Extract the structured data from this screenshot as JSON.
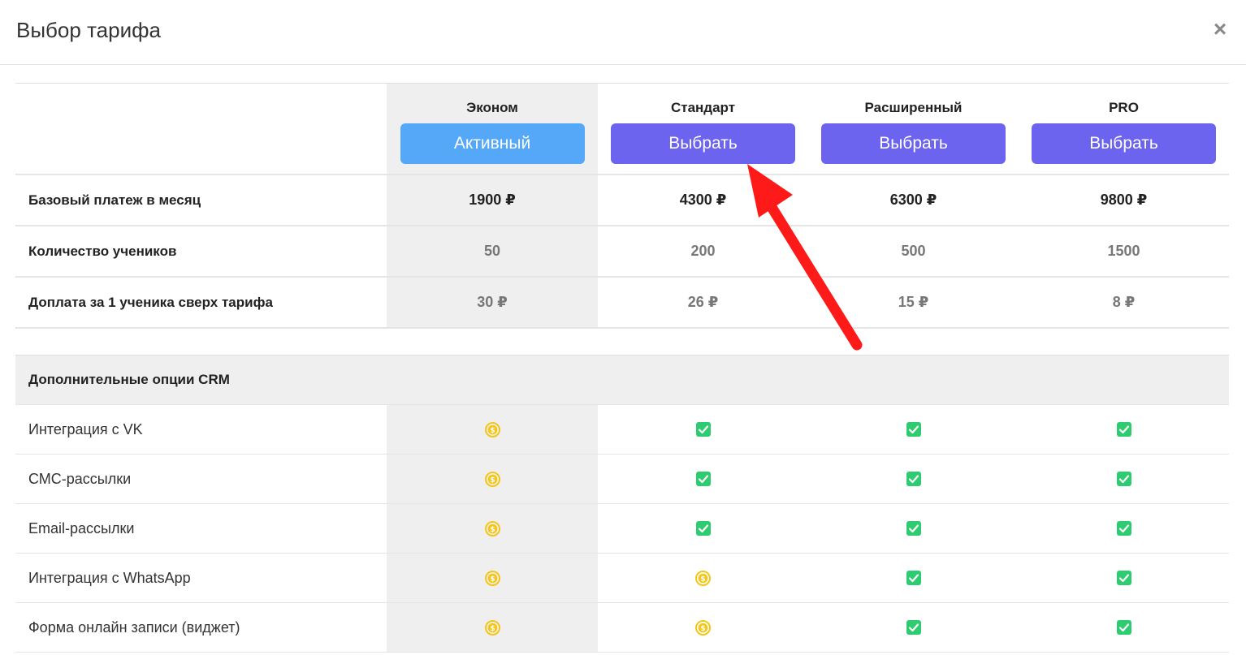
{
  "modal": {
    "title": "Выбор тарифа",
    "close_icon": "close-icon"
  },
  "plans": [
    {
      "name": "Эконом",
      "button": "Активный",
      "state": "active"
    },
    {
      "name": "Стандарт",
      "button": "Выбрать",
      "state": "select"
    },
    {
      "name": "Расширенный",
      "button": "Выбрать",
      "state": "select"
    },
    {
      "name": "PRO",
      "button": "Выбрать",
      "state": "select"
    }
  ],
  "metrics": [
    {
      "label": "Базовый платеж в месяц",
      "values": [
        "1900 ₽",
        "4300 ₽",
        "6300 ₽",
        "9800 ₽"
      ]
    },
    {
      "label": "Количество учеников",
      "values": [
        "50",
        "200",
        "500",
        "1500"
      ]
    },
    {
      "label": "Доплата за 1 ученика сверх тарифа",
      "values": [
        "30 ₽",
        "26 ₽",
        "15 ₽",
        "8 ₽"
      ]
    }
  ],
  "section": {
    "title": "Дополнительные опции CRM"
  },
  "features": [
    {
      "label": "Интеграция с VK",
      "cells": [
        "paid",
        "included",
        "included",
        "included"
      ]
    },
    {
      "label": "СМС-рассылки",
      "cells": [
        "paid",
        "included",
        "included",
        "included"
      ]
    },
    {
      "label": "Email-рассылки",
      "cells": [
        "paid",
        "included",
        "included",
        "included"
      ]
    },
    {
      "label": "Интеграция с WhatsApp",
      "cells": [
        "paid",
        "paid",
        "included",
        "included"
      ]
    },
    {
      "label": "Форма онлайн записи (виджет)",
      "cells": [
        "paid",
        "paid",
        "included",
        "included"
      ]
    }
  ],
  "icons": {
    "included": "checkbox-checked-icon",
    "paid": "dollar-coin-icon"
  },
  "colors": {
    "active_button": "#55a8f8",
    "select_button": "#6c63ef",
    "check": "#2ecc71",
    "coin": "#f5c518",
    "arrow": "#ff1a1a",
    "active_column": "#efefef"
  }
}
